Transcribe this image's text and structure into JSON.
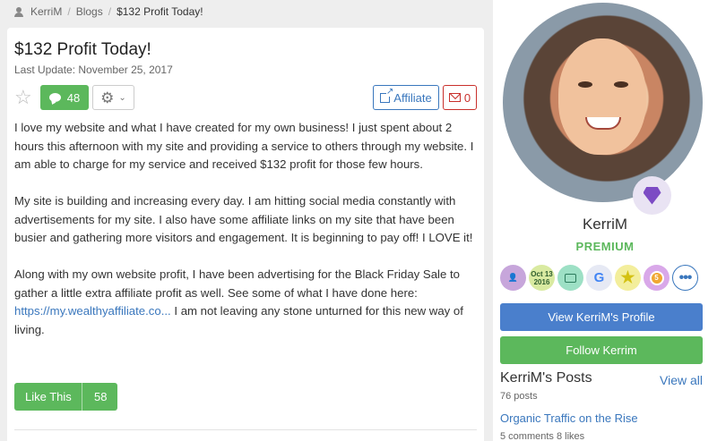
{
  "breadcrumb": {
    "user": "KerriM",
    "section": "Blogs",
    "current": "$132 Profit Today!"
  },
  "post": {
    "title": "$132 Profit Today!",
    "last_update": "Last Update: November 25, 2017",
    "comments_count": "48",
    "affiliate_label": "Affiliate",
    "messages_count": "0",
    "paragraphs": [
      "I love my website and what I have created for my own business! I just spent about 2 hours this afternoon with my site and providing a service to others through my website. I am able to charge for my service and received $132 profit for those few hours.",
      "My site is building and increasing every day. I am hitting social media constantly with advertisements for my site. I also have some affiliate links on my site that have been busier and gathering more visitors and engagement. It is beginning to pay off! I LOVE it!",
      "Along with my own website profit, I have been advertising for the Black Friday Sale to gather a little extra affiliate profit as well. See some of what I have done here:"
    ],
    "link_text": "https://my.wealthyaffiliate.co...",
    "link_tail": " I am not leaving any stone unturned for this new way of living.",
    "like_label": "Like This",
    "like_count": "58"
  },
  "profile": {
    "name": "KerriM",
    "membership": "PREMIUM",
    "badges": [
      {
        "icon": "user-add-icon"
      },
      {
        "icon": "calendar-badge",
        "line1": "Oct 13",
        "line2": "2016"
      },
      {
        "icon": "website-icon"
      },
      {
        "icon": "google-icon",
        "text": "G"
      },
      {
        "icon": "star-icon",
        "text": "★"
      },
      {
        "icon": "medal-icon",
        "text": "5"
      },
      {
        "icon": "more-icon",
        "text": "•••"
      }
    ],
    "view_profile_label": "View KerriM's Profile",
    "follow_label": "Follow Kerrim",
    "posts_title": "KerriM's Posts",
    "view_all": "View all",
    "posts_count": "76 posts",
    "latest_post_title": "Organic Traffic on the Rise",
    "latest_post_meta": "5 comments   8 likes"
  },
  "colors": {
    "green": "#5cb85c",
    "blue": "#4a7fcc",
    "link": "#3a77bd",
    "red": "#c9302c",
    "premium_diamond": "#7c4bc4"
  }
}
